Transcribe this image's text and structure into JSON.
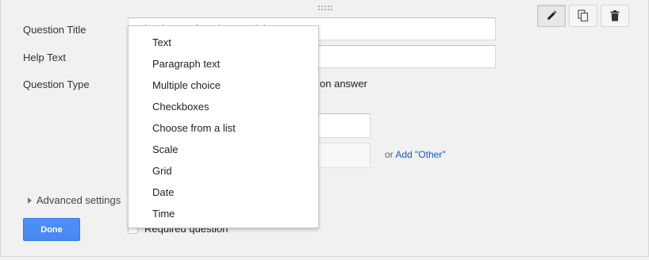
{
  "form": {
    "question_title_label": "Question Title",
    "question_title_value": "What is your favorite Snack item?",
    "help_text_label": "Help Text",
    "help_text_value": "",
    "question_type_label": "Question Type",
    "go_to_page_text": "Go to page based on answer",
    "option_1_value": "",
    "option_2_placeholder": "",
    "or_text": "or",
    "add_other_label": "Add \"Other\"",
    "advanced_settings_label": "Advanced settings",
    "done_label": "Done",
    "required_label": "Required question"
  },
  "toolbar": {
    "edit_icon": "pencil-icon",
    "duplicate_icon": "duplicate-icon",
    "delete_icon": "trash-icon"
  },
  "question_type_menu": {
    "options": [
      "Text",
      "Paragraph text",
      "Multiple choice",
      "Checkboxes",
      "Choose from a list",
      "Scale",
      "Grid",
      "Date",
      "Time"
    ]
  },
  "colors": {
    "primary_button": "#4d90fe",
    "link": "#1155cc",
    "background": "#f1f1f1"
  }
}
